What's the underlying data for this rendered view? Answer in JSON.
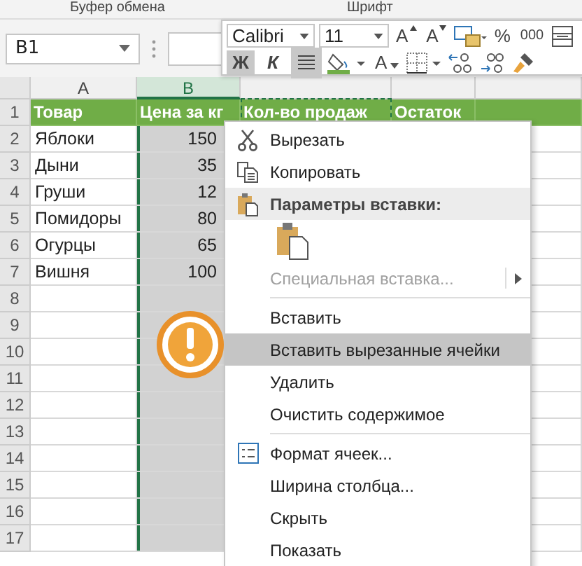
{
  "ribbon": {
    "groups": [
      "Буфер обмена",
      "Шрифт"
    ]
  },
  "name_box": {
    "value": "B1"
  },
  "mini_toolbar": {
    "font": "Calibri",
    "size": "11",
    "grow": "A",
    "shrink": "A",
    "percent": "%",
    "thousands": "000",
    "bold": {
      "label": "Ж",
      "on": true
    },
    "italic": {
      "label": "К",
      "on": false
    },
    "align_on": true,
    "font_color": "A"
  },
  "sheet": {
    "columns": [
      {
        "label": "A",
        "selected": false
      },
      {
        "label": "B",
        "selected": true
      }
    ],
    "rows": [
      {
        "number": "1",
        "header": true,
        "cells": [
          "Товар",
          "Цена за кг",
          "Кол-во продаж",
          "Остаток"
        ]
      },
      {
        "number": "2",
        "cells": [
          "Яблоки",
          "150"
        ]
      },
      {
        "number": "3",
        "cells": [
          "Дыни",
          "35"
        ]
      },
      {
        "number": "4",
        "cells": [
          "Груши",
          "12"
        ]
      },
      {
        "number": "5",
        "cells": [
          "Помидоры",
          "80"
        ]
      },
      {
        "number": "6",
        "cells": [
          "Огурцы",
          "65"
        ]
      },
      {
        "number": "7",
        "cells": [
          "Вишня",
          "100"
        ]
      },
      {
        "number": "8"
      },
      {
        "number": "9"
      },
      {
        "number": "10"
      },
      {
        "number": "11"
      },
      {
        "number": "12"
      },
      {
        "number": "13"
      },
      {
        "number": "14"
      },
      {
        "number": "15"
      },
      {
        "number": "16"
      },
      {
        "number": "17"
      }
    ]
  },
  "context_menu": {
    "items": [
      {
        "kind": "item",
        "label": "Вырезать",
        "selected": false,
        "disabled": false
      },
      {
        "kind": "item",
        "label": "Копировать",
        "selected": false,
        "disabled": false
      },
      {
        "kind": "header",
        "label": "Параметры вставки:"
      },
      {
        "kind": "paste-options"
      },
      {
        "kind": "item",
        "label": "Специальная вставка...",
        "selected": false,
        "disabled": true,
        "submenu": true
      },
      {
        "kind": "separator"
      },
      {
        "kind": "item",
        "label": "Вставить",
        "selected": false,
        "disabled": false
      },
      {
        "kind": "item",
        "label": "Вставить вырезанные ячейки",
        "selected": true,
        "disabled": false
      },
      {
        "kind": "item",
        "label": "Удалить",
        "selected": false,
        "disabled": false
      },
      {
        "kind": "item",
        "label": "Очистить содержимое",
        "selected": false,
        "disabled": false
      },
      {
        "kind": "separator"
      },
      {
        "kind": "item",
        "label": "Формат ячеек...",
        "selected": false,
        "disabled": false
      },
      {
        "kind": "item",
        "label": "Ширина столбца...",
        "selected": false,
        "disabled": false
      },
      {
        "kind": "item",
        "label": "Скрыть",
        "selected": false,
        "disabled": false
      },
      {
        "kind": "item",
        "label": "Показать",
        "selected": false,
        "disabled": false
      }
    ]
  }
}
